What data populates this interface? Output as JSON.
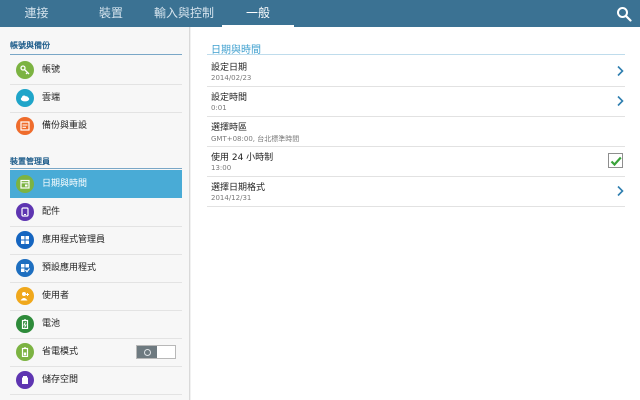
{
  "tabs": [
    {
      "label": "連接"
    },
    {
      "label": "裝置"
    },
    {
      "label": "輸入與控制"
    },
    {
      "label": "一般"
    }
  ],
  "colors": {
    "topbar": "#3b7293",
    "accent": "#49abd6",
    "title": "#3fa0cf"
  },
  "sidebar": {
    "sections": [
      {
        "label": "帳號與備份"
      },
      {
        "label": "裝置管理員"
      }
    ],
    "items": [
      {
        "label": "帳號",
        "icon": "key-icon",
        "color": "#7cb342"
      },
      {
        "label": "雲端",
        "icon": "cloud-icon",
        "color": "#1fa5c9"
      },
      {
        "label": "備份與重設",
        "icon": "backup-icon",
        "color": "#ef6c2c"
      },
      {
        "label": "日期與時間",
        "icon": "calendar-icon",
        "color": "#7cb342"
      },
      {
        "label": "配件",
        "icon": "accessory-icon",
        "color": "#5e35b1"
      },
      {
        "label": "應用程式管理員",
        "icon": "apps-grid-icon",
        "color": "#1565c0"
      },
      {
        "label": "預設應用程式",
        "icon": "default-apps-icon",
        "color": "#1e6fc0"
      },
      {
        "label": "使用者",
        "icon": "users-icon",
        "color": "#f0a81c"
      },
      {
        "label": "電池",
        "icon": "battery-icon",
        "color": "#2e8b3a"
      },
      {
        "label": "省電模式",
        "icon": "power-saving-icon",
        "color": "#7cb342",
        "toggle": "off"
      },
      {
        "label": "儲存空間",
        "icon": "storage-icon",
        "color": "#5e35b1"
      }
    ]
  },
  "content": {
    "title": "日期與時間",
    "rows": [
      {
        "title": "設定日期",
        "sub": "2014/02/23",
        "control": "chevron"
      },
      {
        "title": "設定時間",
        "sub": "0:01",
        "control": "chevron"
      },
      {
        "title": "選擇時區",
        "sub": "GMT+08:00, 台北標準時間",
        "control": "none"
      },
      {
        "title": "使用 24 小時制",
        "sub": "13:00",
        "control": "checkbox",
        "checked": true
      },
      {
        "title": "選擇日期格式",
        "sub": "2014/12/31",
        "control": "chevron"
      }
    ]
  }
}
